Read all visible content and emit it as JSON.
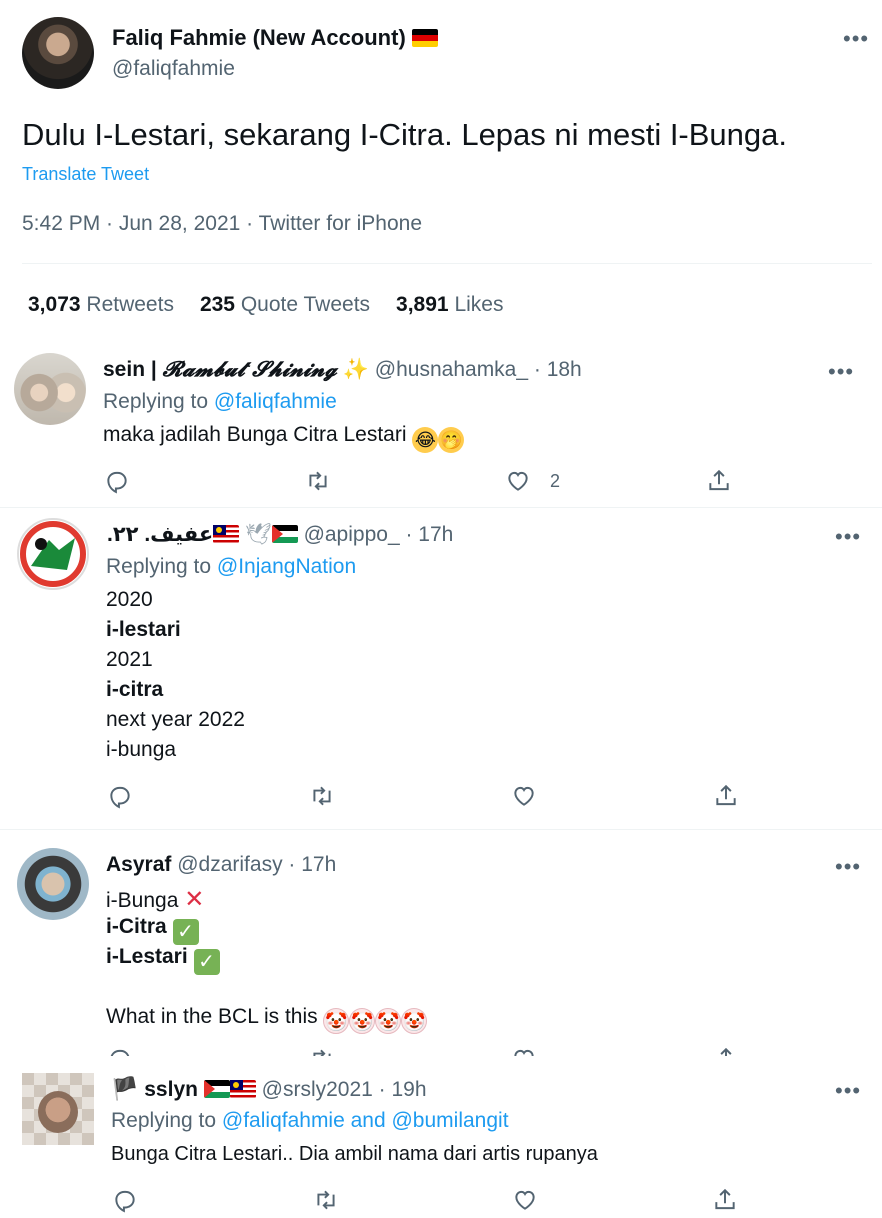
{
  "main_tweet": {
    "display_name": "Faliq Fahmie (New Account)",
    "handle": "@faliqfahmie",
    "text": "Dulu I-Lestari, sekarang I-Citra. Lepas ni mesti I-Bunga.",
    "translate_label": "Translate Tweet",
    "meta": "5:42 PM · Jun 28, 2021 · Twitter for iPhone",
    "stats": {
      "retweets_count": "3,073",
      "retweets_label": "Retweets",
      "quotes_count": "235",
      "quotes_label": "Quote Tweets",
      "likes_count": "3,891",
      "likes_label": "Likes"
    },
    "more_label": "•••"
  },
  "replies": [
    {
      "display_name_prefix": "sein | ",
      "display_name_styled": "𝓡𝓪𝓶𝓫𝓾𝓽 𝓢𝓱𝓲𝓷𝓲𝓷𝓰",
      "handle_time": "@husnahamka_ · 18h",
      "replying_prefix": "Replying to ",
      "replying_to": "@faliqfahmie",
      "text": "maka jadilah Bunga Citra Lestari",
      "like_count": "2",
      "more_label": "•••"
    },
    {
      "display_name": ".عفيف. ٢٢",
      "handle_time": "@apippo_ · 17h",
      "replying_prefix": "Replying to ",
      "replying_to": "@InjangNation",
      "lines": [
        "2020",
        "i-lestari",
        "2021",
        "i-citra",
        "next year 2022",
        "i-bunga"
      ],
      "more_label": "•••"
    },
    {
      "display_name": "Asyraf",
      "handle_time": "@dzarifasy · 17h",
      "lines": [
        "i-Bunga",
        "i-Citra",
        "i-Lestari",
        "What in the BCL is this"
      ],
      "more_label": "•••"
    },
    {
      "display_name": "sslyn",
      "handle_time": "@srsly2021 · 19h",
      "replying_prefix": "Replying to ",
      "replying_to": "@faliqfahmie and @bumilangit",
      "text": "Bunga Citra Lestari.. Dia ambil nama dari artis rupanya",
      "more_label": "•••"
    }
  ],
  "colors": {
    "link": "#1d9bf0",
    "muted": "#536471",
    "text": "#0f1419"
  }
}
